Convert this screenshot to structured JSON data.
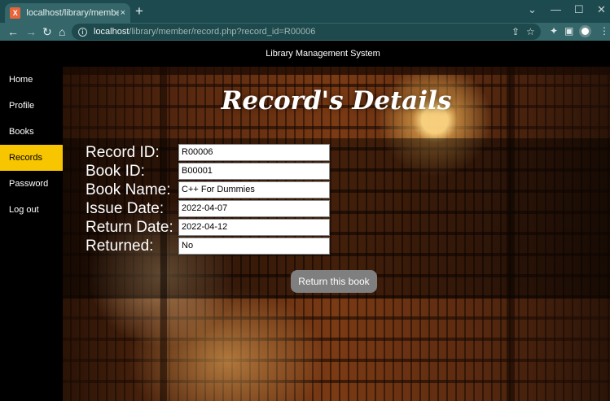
{
  "browser": {
    "tab_title": "localhost/library/member/record",
    "tab_close": "×",
    "new_tab": "+",
    "favicon": "X",
    "url_host": "localhost",
    "url_path": "/library/member/record.php?record_id=R00006",
    "icons": [
      "back-arrow-icon",
      "forward-arrow-icon",
      "reload-icon",
      "home-icon",
      "info-icon",
      "share-icon",
      "star-icon",
      "extensions-icon",
      "sidepanel-icon",
      "profile-avatar-icon",
      "menu-icon"
    ],
    "colors": {
      "tabstrip": "#1c4a4e",
      "toolbar": "#35676a"
    }
  },
  "site": {
    "header": "Library Management System"
  },
  "sidebar": {
    "items": [
      {
        "label": "Home"
      },
      {
        "label": "Profile"
      },
      {
        "label": "Books"
      },
      {
        "label": "Records",
        "active": true
      },
      {
        "label": "Password"
      },
      {
        "label": "Log out"
      }
    ],
    "active_color": "#f7c600"
  },
  "main": {
    "title": "Record's Details",
    "fields": [
      {
        "label": "Record ID:",
        "value": "R00006"
      },
      {
        "label": "Book ID:",
        "value": "B00001"
      },
      {
        "label": "Book Name:",
        "value": "C++ For Dummies"
      },
      {
        "label": "Issue Date:",
        "value": "2022-04-07"
      },
      {
        "label": "Return Date:",
        "value": "2022-04-12"
      },
      {
        "label": "Returned:",
        "value": "No"
      }
    ],
    "return_button": "Return this book"
  }
}
